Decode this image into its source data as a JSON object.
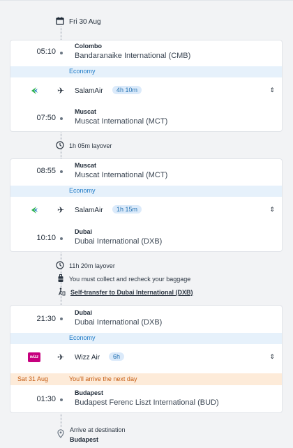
{
  "date_header": "Fri 30 Aug",
  "segments": [
    {
      "dep_time": "05:10",
      "dep_city": "Colombo",
      "dep_airport": "Bandaranaike International (CMB)",
      "cabin": "Economy",
      "airline": "SalamAir",
      "duration": "4h 10m",
      "arr_time": "07:50",
      "arr_city": "Muscat",
      "arr_airport": "Muscat International (MCT)"
    },
    {
      "dep_time": "08:55",
      "dep_city": "Muscat",
      "dep_airport": "Muscat International (MCT)",
      "cabin": "Economy",
      "airline": "SalamAir",
      "duration": "1h 15m",
      "arr_time": "10:10",
      "arr_city": "Dubai",
      "arr_airport": "Dubai International (DXB)"
    },
    {
      "dep_time": "21:30",
      "dep_city": "Dubai",
      "dep_airport": "Dubai International (DXB)",
      "cabin": "Economy",
      "airline": "Wizz Air",
      "duration": "6h",
      "next_day_date": "Sat 31 Aug",
      "next_day_msg": "You'll arrive the next day",
      "arr_time": "01:30",
      "arr_city": "Budapest",
      "arr_airport": "Budapest Ferenc Liszt International (BUD)"
    }
  ],
  "layover1": "1h 05m layover",
  "layover2": "11h 20m layover",
  "baggage_note": "You must collect and recheck your baggage",
  "self_transfer": "Self-transfer to Dubai International (DXB)",
  "arrive_label": "Arrive at destination",
  "arrive_city": "Budapest",
  "wizz_logo_text": "wizz",
  "colors": {
    "accent": "#1f7bc7",
    "warning": "#c55b10",
    "salamair_green": "#2fb24c",
    "wizz_pink": "#c6007e"
  }
}
